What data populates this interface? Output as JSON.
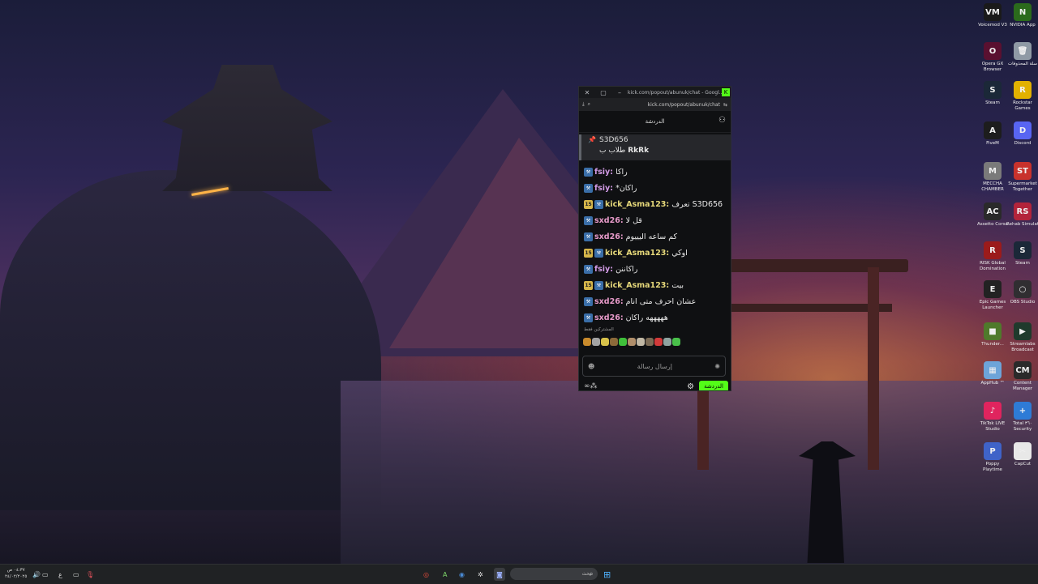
{
  "browser": {
    "title": "kick.com/popout/abunuk/chat - Googl...",
    "url": "kick.com/popout/abunuk/chat"
  },
  "chat": {
    "header": "الدردشة",
    "pinned": {
      "user": "S3D656",
      "message_prefix": "طلاب ب",
      "message_name": "RkRk"
    },
    "messages": [
      {
        "user": "fsiy",
        "color": "#d39be6",
        "badges": [
          "kick"
        ],
        "text": "راكا"
      },
      {
        "user": "fsiy",
        "color": "#d39be6",
        "badges": [
          "kick"
        ],
        "text": "*راكان"
      },
      {
        "user": "kick_Asma123",
        "color": "#e6d87a",
        "badges": [
          "sub",
          "kick"
        ],
        "text": "تعرف S3D656"
      },
      {
        "user": "sxd26",
        "color": "#e79ac9",
        "badges": [
          "kick"
        ],
        "text": "قل لا"
      },
      {
        "user": "sxd26",
        "color": "#e79ac9",
        "badges": [
          "kick"
        ],
        "text": "كم ساعه اليييوم"
      },
      {
        "user": "kick_Asma123",
        "color": "#e6d87a",
        "badges": [
          "sub",
          "kick"
        ],
        "text": "اوكي"
      },
      {
        "user": "fsiy",
        "color": "#d39be6",
        "badges": [
          "kick"
        ],
        "text": "راكاننن"
      },
      {
        "user": "kick_Asma123",
        "color": "#e6d87a",
        "badges": [
          "sub",
          "kick"
        ],
        "text": "بيت"
      },
      {
        "user": "sxd26",
        "color": "#e79ac9",
        "badges": [
          "kick"
        ],
        "text": "عشان احرف متى انام"
      },
      {
        "user": "sxd26",
        "color": "#e79ac9",
        "badges": [
          "kick"
        ],
        "text": "هههههه راكان"
      }
    ],
    "sub_badge_text": "15",
    "emote_label": "المشتركين فقط",
    "input_placeholder": "إرسال رسالة",
    "send_label": "الدردشة",
    "footer_left": "∞"
  },
  "desktop_icons": [
    {
      "label": "Voicemod V3",
      "color": "#1a1a1a",
      "glyph": "VM"
    },
    {
      "label": "NVIDIA App",
      "color": "#2b6b1c",
      "glyph": "N"
    },
    {
      "label": "Opera GX Browser",
      "color": "#5a1030",
      "glyph": "O"
    },
    {
      "label": "سلة المحذوفات",
      "color": "#8f9aa5",
      "glyph": "🗑"
    },
    {
      "label": "Steam",
      "color": "#1b2838",
      "glyph": "S"
    },
    {
      "label": "Rockstar Games",
      "color": "#e2b100",
      "glyph": "R"
    },
    {
      "label": "FiveM",
      "color": "#1d1d1d",
      "glyph": "A"
    },
    {
      "label": "Discord",
      "color": "#5865f2",
      "glyph": "D"
    },
    {
      "label": "MECCHA CHAMBER",
      "color": "#7a7a7a",
      "glyph": "M"
    },
    {
      "label": "Supermarket Together",
      "color": "#c8322c",
      "glyph": "ST"
    },
    {
      "label": "Assetto Corsa",
      "color": "#2a2a2a",
      "glyph": "AC"
    },
    {
      "label": "Rehab Simulat",
      "color": "#b3243b",
      "glyph": "RS"
    },
    {
      "label": "RISK Global Domination",
      "color": "#9b1b1b",
      "glyph": "R"
    },
    {
      "label": "Steam",
      "color": "#1b2838",
      "glyph": "S"
    },
    {
      "label": "Epic Games Launcher",
      "color": "#222",
      "glyph": "E"
    },
    {
      "label": "OBS Studio",
      "color": "#302e31",
      "glyph": "○"
    },
    {
      "label": "Thunder...",
      "color": "#4f7a2b",
      "glyph": "■"
    },
    {
      "label": "Streamlabs Broadcast",
      "color": "#1f3a2c",
      "glyph": "▶"
    },
    {
      "label": "AppHub ™",
      "color": "#6da4d8",
      "glyph": "▦"
    },
    {
      "label": "Content Manager",
      "color": "#2a2a2a",
      "glyph": "CM"
    },
    {
      "label": "TikTok LIVE Studio",
      "color": "#e0245e",
      "glyph": "♪"
    },
    {
      "label": "Total ٣٦٠ Security",
      "color": "#2e7bd6",
      "glyph": "+"
    },
    {
      "label": "Poppy Playtime",
      "color": "#3f63c8",
      "glyph": "P"
    },
    {
      "label": "CapCut",
      "color": "#e8e8e8",
      "glyph": "✂"
    }
  ],
  "taskbar": {
    "search_placeholder": "بحث",
    "clock_time": "٠٤:٣٧ ص",
    "clock_date": "٢٤/٠٢/٢٠٢٥",
    "lang": "ع"
  }
}
